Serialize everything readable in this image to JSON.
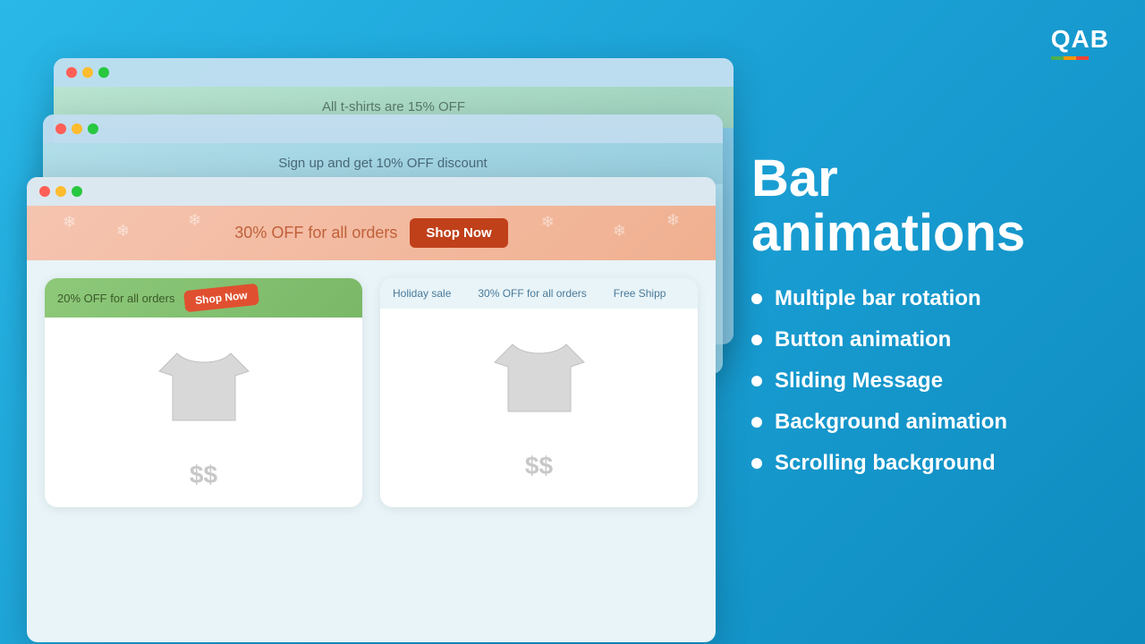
{
  "logo": {
    "text": "QAB",
    "bars": [
      "green",
      "orange",
      "red"
    ]
  },
  "main_title": "Bar animations",
  "features": [
    {
      "id": "multiple-bar",
      "label": "Multiple bar rotation"
    },
    {
      "id": "button-animation",
      "label": "Button animation"
    },
    {
      "id": "sliding-message",
      "label": "Sliding Message"
    },
    {
      "id": "background-animation",
      "label": "Background animation"
    },
    {
      "id": "scrolling-background",
      "label": "Scrolling background"
    }
  ],
  "browser_back": {
    "bar_text": "All t-shirts are 15% OFF"
  },
  "browser_mid": {
    "bar_text": "Sign up and get 10% OFF discount"
  },
  "browser_front": {
    "announcement": {
      "text": "30% OFF for all orders",
      "button": "Shop Now"
    },
    "cards": [
      {
        "mini_bar_text": "20% OFF for all orders",
        "mini_bar_btn": "Shop Now",
        "price": "$$"
      },
      {
        "scroll_items": [
          "Holiday sale",
          "30% OFF for all orders",
          "Free Shipp"
        ],
        "price": "$$"
      }
    ]
  }
}
